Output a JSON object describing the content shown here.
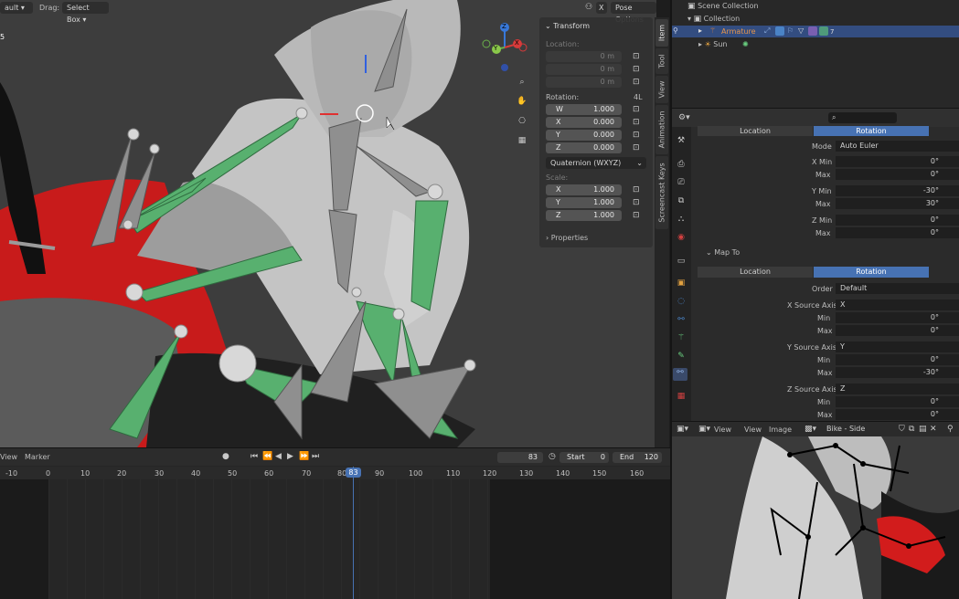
{
  "viewport_header": {
    "mode_partial": "ault",
    "drag_label": "Drag:",
    "drag_value": "Select Box",
    "pose_options": "Pose Options",
    "x_label": "X",
    "num_fragment": "5"
  },
  "gizmo": {
    "z": "Z",
    "y": "Y",
    "x": "X"
  },
  "transform": {
    "title": "Transform",
    "location_label": "Location:",
    "location": [
      {
        "axis": "X",
        "value": "0 m"
      },
      {
        "axis": "Y",
        "value": "0 m"
      },
      {
        "axis": "Z",
        "value": "0 m"
      }
    ],
    "rotation_label": "Rotation:",
    "rotation_mode_short": "4L",
    "rotation": [
      {
        "axis": "W",
        "value": "1.000"
      },
      {
        "axis": "X",
        "value": "0.000"
      },
      {
        "axis": "Y",
        "value": "0.000"
      },
      {
        "axis": "Z",
        "value": "0.000"
      }
    ],
    "rotation_mode": "Quaternion (WXYZ)",
    "scale_label": "Scale:",
    "scale": [
      {
        "axis": "X",
        "value": "1.000"
      },
      {
        "axis": "Y",
        "value": "1.000"
      },
      {
        "axis": "Z",
        "value": "1.000"
      }
    ],
    "properties": "Properties"
  },
  "side_tabs": [
    "Item",
    "Tool",
    "View",
    "Animation",
    "Screencast Keys"
  ],
  "outliner": {
    "scene_collection": "Scene Collection",
    "collection": "Collection",
    "armature": "Armature",
    "sun": "Sun",
    "badge_count": "7"
  },
  "properties": {
    "tab_location": "Location",
    "tab_rotation": "Rotation",
    "mode_label": "Mode",
    "mode_value": "Auto Euler",
    "from_rows": [
      {
        "label": "X Min",
        "value": "0°"
      },
      {
        "label": "Max",
        "value": "0°"
      },
      {
        "label": "Y Min",
        "value": "-30°"
      },
      {
        "label": "Max",
        "value": "30°"
      },
      {
        "label": "Z Min",
        "value": "0°"
      },
      {
        "label": "Max",
        "value": "0°"
      }
    ],
    "map_to": "Map To",
    "order_label": "Order",
    "order_value": "Default",
    "x_source_label": "X Source Axis",
    "x_source_value": "X",
    "x_rows": [
      {
        "label": "Min",
        "value": "0°"
      },
      {
        "label": "Max",
        "value": "0°"
      }
    ],
    "y_source_label": "Y Source Axis",
    "y_source_value": "Y",
    "y_rows": [
      {
        "label": "Min",
        "value": "0°"
      },
      {
        "label": "Max",
        "value": "-30°"
      }
    ],
    "z_source_label": "Z Source Axis",
    "z_source_value": "Z",
    "z_rows": [
      {
        "label": "Min",
        "value": "0°"
      },
      {
        "label": "Max",
        "value": "0°"
      }
    ]
  },
  "image_editor": {
    "view": "View",
    "view2": "View",
    "image": "Image",
    "filename": "Bike - Side Pose.png"
  },
  "timeline": {
    "view": "View",
    "marker": "Marker",
    "current_frame": "83",
    "start_label": "Start",
    "start_value": "0",
    "end_label": "End",
    "end_value": "120",
    "playhead": "83",
    "ticks": [
      "-10",
      "0",
      "10",
      "20",
      "30",
      "40",
      "50",
      "60",
      "70",
      "80",
      "90",
      "100",
      "110",
      "120",
      "130",
      "140",
      "150",
      "160"
    ]
  },
  "colors": {
    "accent": "#4772b3",
    "bone_green": "#4fa86a",
    "bike_red": "#c21a1a",
    "armature_orange": "#e0803a"
  }
}
